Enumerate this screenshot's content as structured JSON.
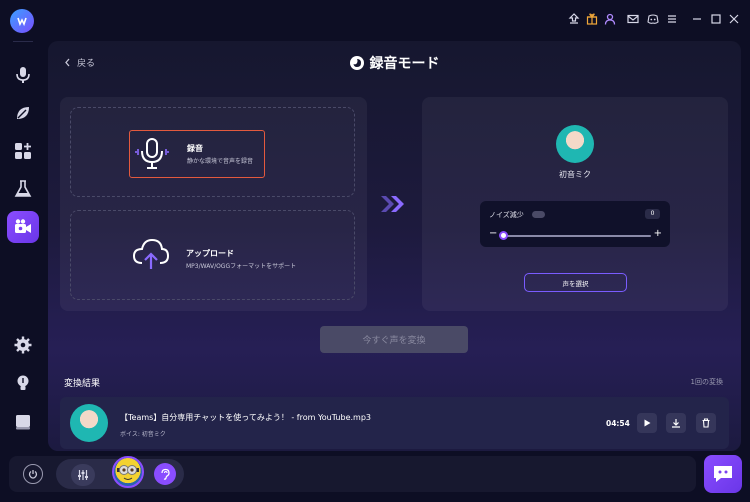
{
  "app": {
    "accent": "#8a4dff",
    "record_border": "#e35a3e"
  },
  "sidebar": {
    "items": [
      {
        "icon": "microphone-icon"
      },
      {
        "icon": "leaf-icon"
      },
      {
        "icon": "apps-add-icon"
      },
      {
        "icon": "flask-icon"
      },
      {
        "icon": "video-record-icon"
      },
      {
        "icon": "gear-icon"
      },
      {
        "icon": "lightbulb-icon"
      },
      {
        "icon": "book-icon"
      }
    ]
  },
  "titlebar": {
    "icons": [
      "upload-icon",
      "gift-icon",
      "user-icon",
      "mail-icon",
      "discord-icon",
      "menu-icon",
      "minimize-icon",
      "maximize-icon",
      "close-icon"
    ]
  },
  "header": {
    "back_label": "戻る",
    "title": "録音モード"
  },
  "options": {
    "record": {
      "title": "録音",
      "subtitle": "静かな環境で音声を録音"
    },
    "upload": {
      "title": "アップロード",
      "subtitle": "MP3/WAV/OGGフォーマットをサポート"
    }
  },
  "voice_panel": {
    "voice_name": "初音ミク",
    "noise_label": "ノイズ減少",
    "noise_value": "0",
    "noise_level": 0,
    "minus": "−",
    "plus": "+",
    "select_button": "声を選択"
  },
  "convert_button": "今すぐ声を変換",
  "results": {
    "title": "変換結果",
    "count": "1回の変換",
    "items": [
      {
        "title": "【Teams】自分専用チャットを使ってみよう！ - from YouTube.mp3",
        "voice": "ボイス: 初音ミク",
        "duration": "04:54"
      }
    ]
  }
}
